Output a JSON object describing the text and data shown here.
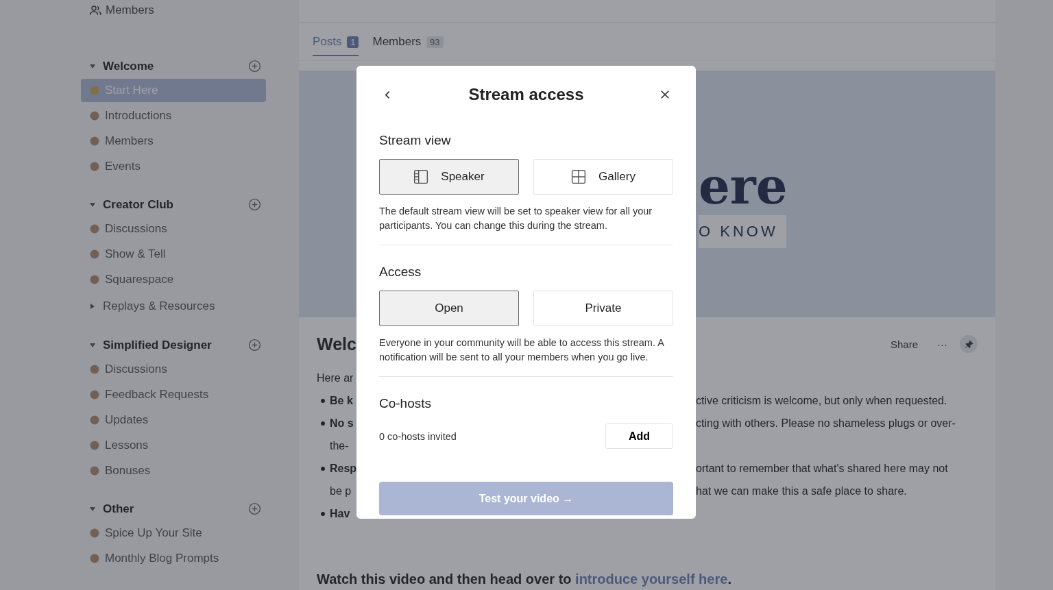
{
  "sidebar": {
    "top_item": {
      "label": "Members"
    },
    "sections": [
      {
        "title": "Welcome",
        "expanded": true,
        "items": [
          {
            "kind": "channel",
            "label": "Start Here",
            "selected": true
          },
          {
            "kind": "channel",
            "label": "Introductions",
            "selected": false
          },
          {
            "kind": "channel",
            "label": "Members",
            "selected": false
          },
          {
            "kind": "channel",
            "label": "Events",
            "selected": false
          }
        ]
      },
      {
        "title": "Creator Club",
        "expanded": true,
        "items": [
          {
            "kind": "channel",
            "label": "Discussions",
            "selected": false
          },
          {
            "kind": "channel",
            "label": "Show & Tell",
            "selected": false
          },
          {
            "kind": "channel",
            "label": "Squarespace",
            "selected": false
          },
          {
            "kind": "folder",
            "label": "Replays & Resources",
            "expanded": false
          }
        ]
      },
      {
        "title": "Simplified Designer",
        "expanded": true,
        "items": [
          {
            "kind": "channel",
            "label": "Discussions",
            "selected": false
          },
          {
            "kind": "channel",
            "label": "Feedback Requests",
            "selected": false
          },
          {
            "kind": "channel",
            "label": "Updates",
            "selected": false
          },
          {
            "kind": "channel",
            "label": "Lessons",
            "selected": false
          },
          {
            "kind": "channel",
            "label": "Bonuses",
            "selected": false
          }
        ]
      },
      {
        "title": "Other",
        "expanded": true,
        "items": [
          {
            "kind": "channel",
            "label": "Spice Up Your Site",
            "selected": false
          },
          {
            "kind": "channel",
            "label": "Monthly Blog Prompts",
            "selected": false
          }
        ]
      }
    ]
  },
  "tabs": [
    {
      "label": "Posts",
      "count": "1",
      "selected": true
    },
    {
      "label": "Members",
      "count": "93",
      "selected": false
    }
  ],
  "hero": {
    "title": "ere",
    "subtitle": "O KNOW"
  },
  "post": {
    "title": "Welc",
    "actions": {
      "share": "Share",
      "more": "···"
    },
    "lines": [
      {
        "bullet": false,
        "left": "Here ar"
      },
      {
        "bullet": true,
        "left": "Be k",
        "right": "ctive criticism is welcome, but only when requested."
      },
      {
        "bullet": true,
        "left": "No s",
        "right": "cting with others. Please no shameless plugs or over-"
      },
      {
        "bullet": false,
        "left": "the-"
      },
      {
        "bullet": true,
        "left": "Resp",
        "right": "ortant to remember that what's shared here may not"
      },
      {
        "bullet": false,
        "left": "be p",
        "right": "hat we can make this a safe place to share."
      },
      {
        "bullet": true,
        "left": "Hav"
      }
    ],
    "video_line": {
      "text": "Watch this video and then head over to ",
      "link": "introduce yourself here",
      "end": "."
    }
  },
  "modal": {
    "title": "Stream access",
    "sections": [
      {
        "heading": "Stream view",
        "options": [
          {
            "kind": "speaker",
            "label": "Speaker",
            "selected": true
          },
          {
            "kind": "gallery",
            "label": "Gallery",
            "selected": false
          }
        ],
        "description": "The default stream view will be set to speaker view for all your participants. You can change this during the stream."
      },
      {
        "heading": "Access",
        "options": [
          {
            "kind": "plain",
            "label": "Open",
            "selected": true
          },
          {
            "kind": "plain",
            "label": "Private",
            "selected": false
          }
        ],
        "description": "Everyone in your community will be able to access this stream. A notification will be sent to all your members when you go live."
      }
    ],
    "cohosts": {
      "heading": "Co-hosts",
      "status": "0 co-hosts invited",
      "button": "Add"
    },
    "primary_button": {
      "label": "Test your video →",
      "disabled": true
    }
  }
}
